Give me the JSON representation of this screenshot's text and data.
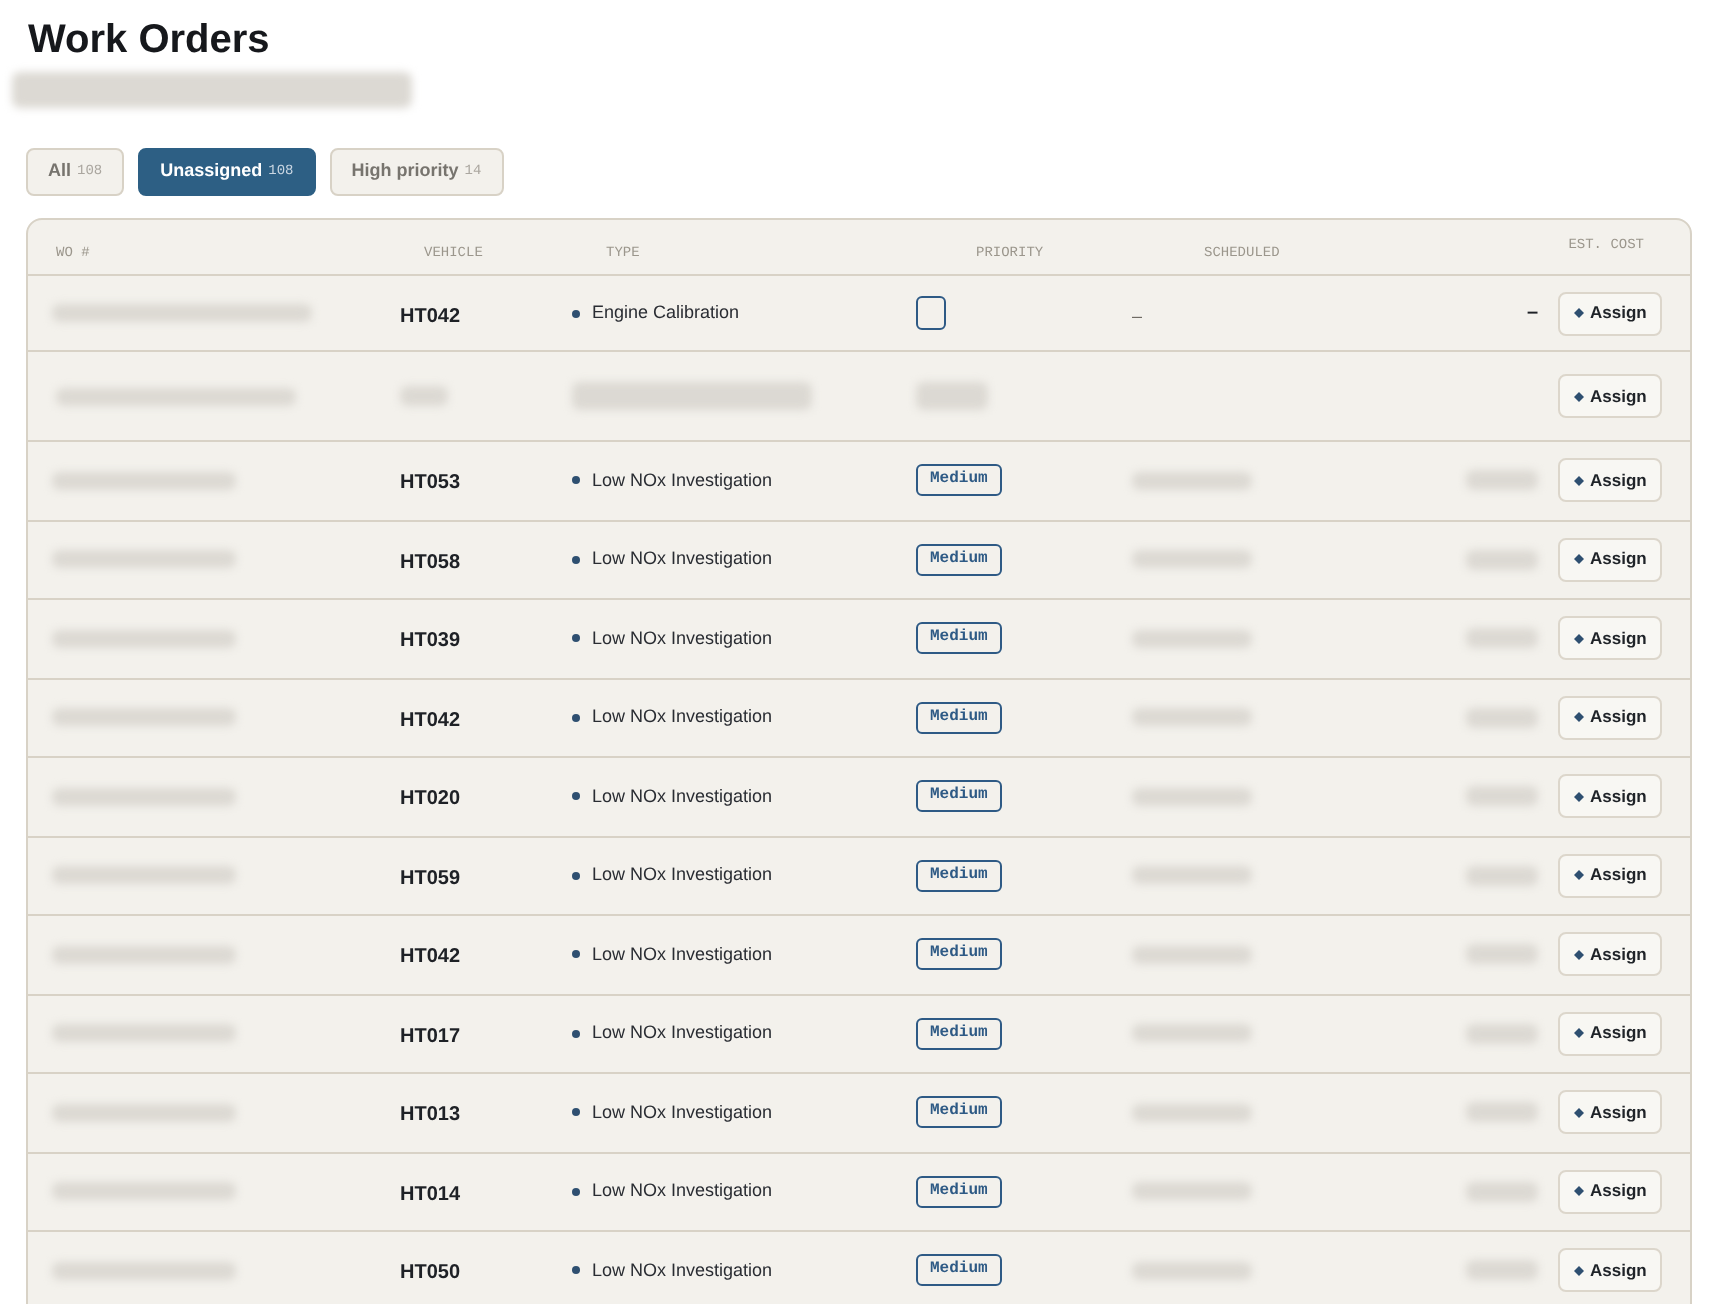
{
  "page": {
    "title": "Work Orders"
  },
  "tabs": [
    {
      "label": "All",
      "count": "108",
      "selected": false
    },
    {
      "label": "Unassigned",
      "count": "108",
      "selected": true
    },
    {
      "label": "High priority",
      "count": "14",
      "selected": false
    }
  ],
  "table": {
    "columns": [
      "WO #",
      "VEHICLE",
      "TYPE",
      "PRIORITY",
      "SCHEDULED",
      "EST. COST"
    ],
    "rows": [
      {
        "kind": "full",
        "vehicle": "HT042",
        "type": "Engine Calibration",
        "priority": {
          "kind": "blank"
        },
        "scheduled": "–",
        "est_cost": "–",
        "action": "Assign"
      },
      {
        "kind": "hidden",
        "action": "Assign"
      },
      {
        "kind": "partial",
        "vehicle": "HT053",
        "type": "Low NOx Investigation",
        "priority": {
          "kind": "label",
          "text": "Medium"
        },
        "action": "Assign"
      },
      {
        "kind": "partial",
        "vehicle": "HT058",
        "type": "Low NOx Investigation",
        "priority": {
          "kind": "label",
          "text": "Medium"
        },
        "action": "Assign"
      },
      {
        "kind": "partial",
        "vehicle": "HT039",
        "type": "Low NOx Investigation",
        "priority": {
          "kind": "label",
          "text": "Medium"
        },
        "action": "Assign"
      },
      {
        "kind": "partial",
        "vehicle": "HT042",
        "type": "Low NOx Investigation",
        "priority": {
          "kind": "label",
          "text": "Medium"
        },
        "action": "Assign"
      },
      {
        "kind": "partial",
        "vehicle": "HT020",
        "type": "Low NOx Investigation",
        "priority": {
          "kind": "label",
          "text": "Medium"
        },
        "action": "Assign"
      },
      {
        "kind": "partial",
        "vehicle": "HT059",
        "type": "Low NOx Investigation",
        "priority": {
          "kind": "label",
          "text": "Medium"
        },
        "action": "Assign"
      },
      {
        "kind": "partial",
        "vehicle": "HT042",
        "type": "Low NOx Investigation",
        "priority": {
          "kind": "label",
          "text": "Medium"
        },
        "action": "Assign"
      },
      {
        "kind": "partial",
        "vehicle": "HT017",
        "type": "Low NOx Investigation",
        "priority": {
          "kind": "label",
          "text": "Medium"
        },
        "action": "Assign"
      },
      {
        "kind": "partial",
        "vehicle": "HT013",
        "type": "Low NOx Investigation",
        "priority": {
          "kind": "label",
          "text": "Medium"
        },
        "action": "Assign"
      },
      {
        "kind": "partial",
        "vehicle": "HT014",
        "type": "Low NOx Investigation",
        "priority": {
          "kind": "label",
          "text": "Medium"
        },
        "action": "Assign"
      },
      {
        "kind": "partial",
        "vehicle": "HT050",
        "type": "Low NOx Investigation",
        "priority": {
          "kind": "label",
          "text": "Medium"
        },
        "action": "Assign"
      }
    ]
  }
}
